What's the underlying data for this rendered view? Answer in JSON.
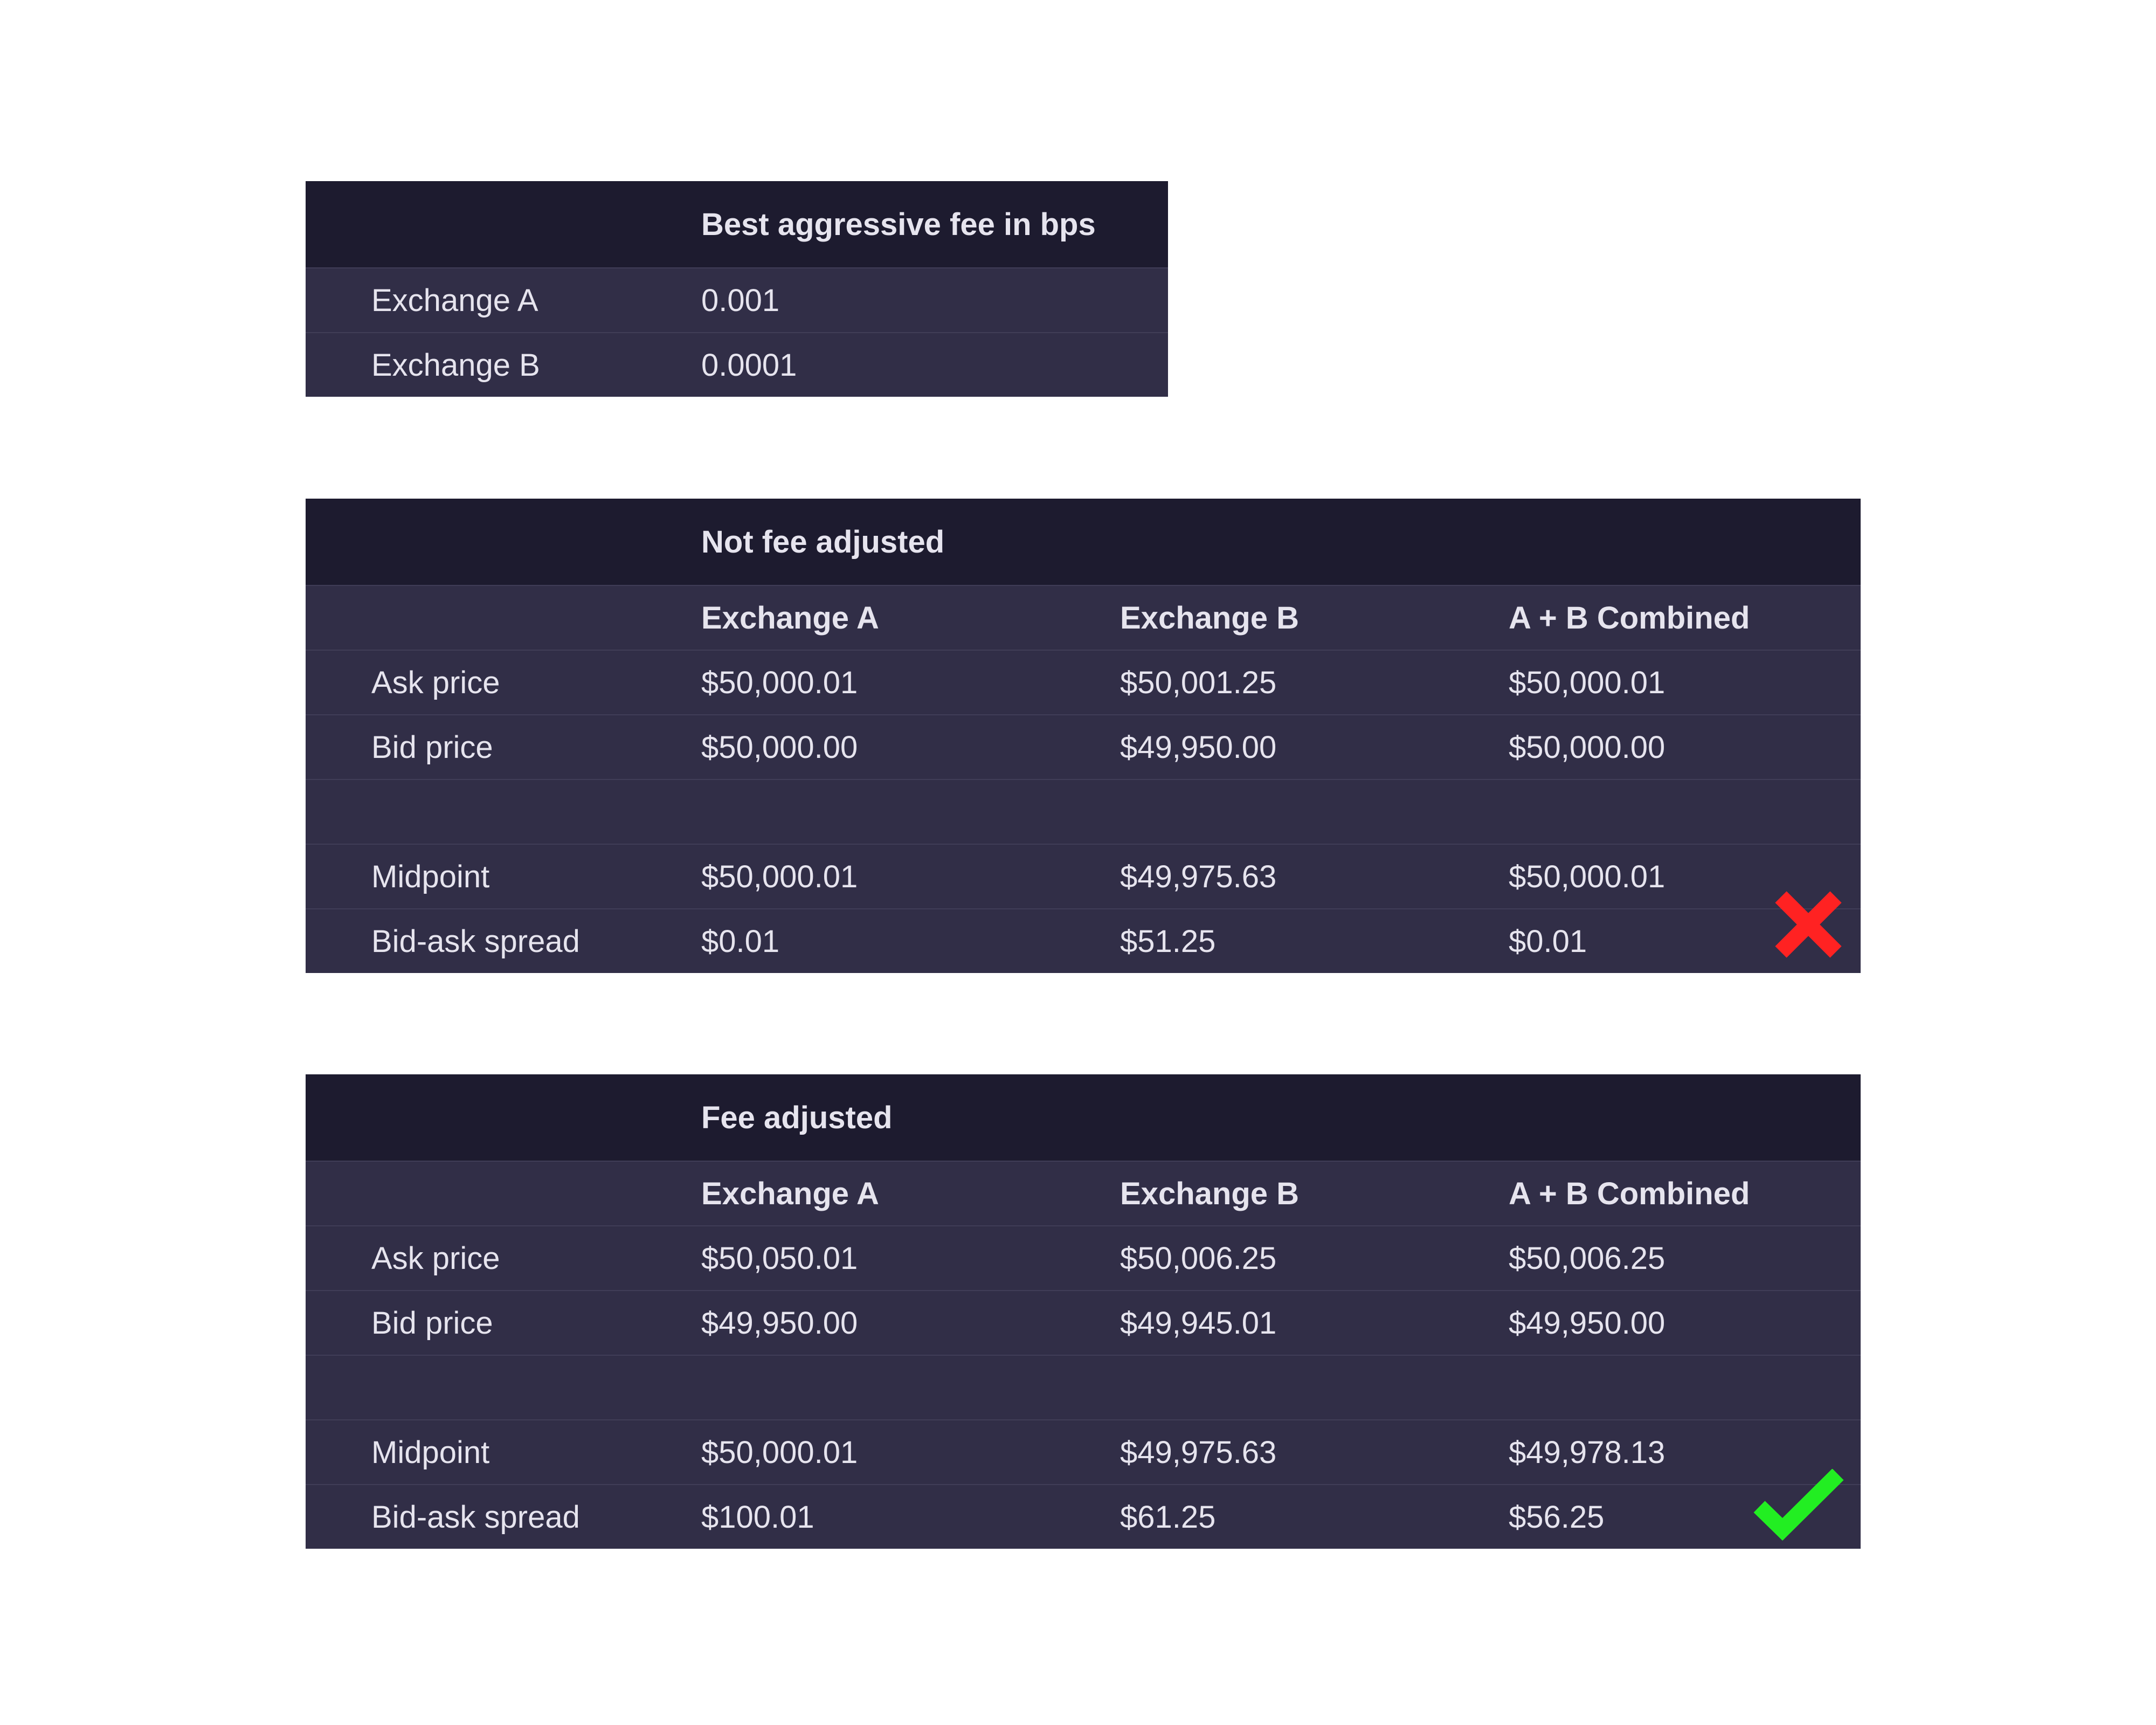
{
  "fees_table": {
    "header": "Best aggressive fee in bps",
    "rows": [
      {
        "label": "Exchange A",
        "value": "0.001"
      },
      {
        "label": "Exchange B",
        "value": "0.0001"
      }
    ]
  },
  "not_fee_adjusted": {
    "title": "Not fee adjusted",
    "columns": [
      "Exchange A",
      "Exchange B",
      "A + B Combined"
    ],
    "rows": [
      {
        "label": "Ask price",
        "values": [
          "$50,000.01",
          "$50,001.25",
          "$50,000.01"
        ]
      },
      {
        "label": "Bid price",
        "values": [
          "$50,000.00",
          "$49,950.00",
          "$50,000.00"
        ]
      },
      {
        "label": "",
        "values": [
          "",
          "",
          ""
        ]
      },
      {
        "label": "Midpoint",
        "values": [
          "$50,000.01",
          "$49,975.63",
          "$50,000.01"
        ]
      },
      {
        "label": "Bid-ask spread",
        "values": [
          "$0.01",
          "$51.25",
          "$0.01"
        ]
      }
    ],
    "status_icon": "red-x-icon",
    "status_color": "#ff2222"
  },
  "fee_adjusted": {
    "title": "Fee adjusted",
    "columns": [
      "Exchange A",
      "Exchange B",
      "A + B Combined"
    ],
    "rows": [
      {
        "label": "Ask price",
        "values": [
          "$50,050.01",
          "$50,006.25",
          "$50,006.25"
        ]
      },
      {
        "label": "Bid price",
        "values": [
          "$49,950.00",
          "$49,945.01",
          "$49,950.00"
        ]
      },
      {
        "label": "",
        "values": [
          "",
          "",
          ""
        ]
      },
      {
        "label": "Midpoint",
        "values": [
          "$50,000.01",
          "$49,975.63",
          "$49,978.13"
        ]
      },
      {
        "label": "Bid-ask spread",
        "values": [
          "$100.01",
          "$61.25",
          "$56.25"
        ]
      }
    ],
    "status_icon": "green-check-icon",
    "status_color": "#22ee22"
  }
}
